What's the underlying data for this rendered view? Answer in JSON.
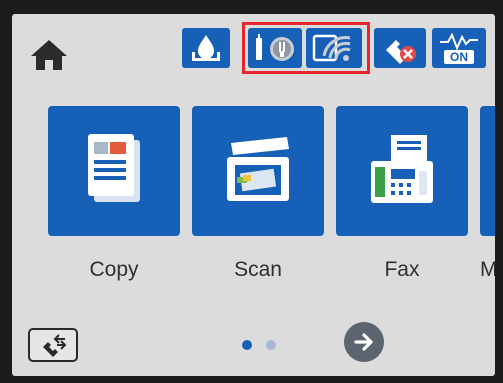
{
  "status_bar": {
    "icons": [
      "home-icon",
      "ink-level-icon",
      "wifi-direct-icon",
      "wifi-icon",
      "fax-off-icon",
      "quiet-mode-on-icon"
    ],
    "quiet_mode_label": "ON",
    "highlight_color": "#e6262e"
  },
  "apps": [
    {
      "label": "Copy",
      "icon": "copy-icon"
    },
    {
      "label": "Scan",
      "icon": "scan-icon"
    },
    {
      "label": "Fax",
      "icon": "fax-icon"
    },
    {
      "label": "M",
      "icon": "more-icon"
    }
  ],
  "pagination": {
    "total_pages": 2,
    "current_page": 1
  },
  "colors": {
    "accent": "#1660b8",
    "screen_bg": "#dcdcdc"
  }
}
